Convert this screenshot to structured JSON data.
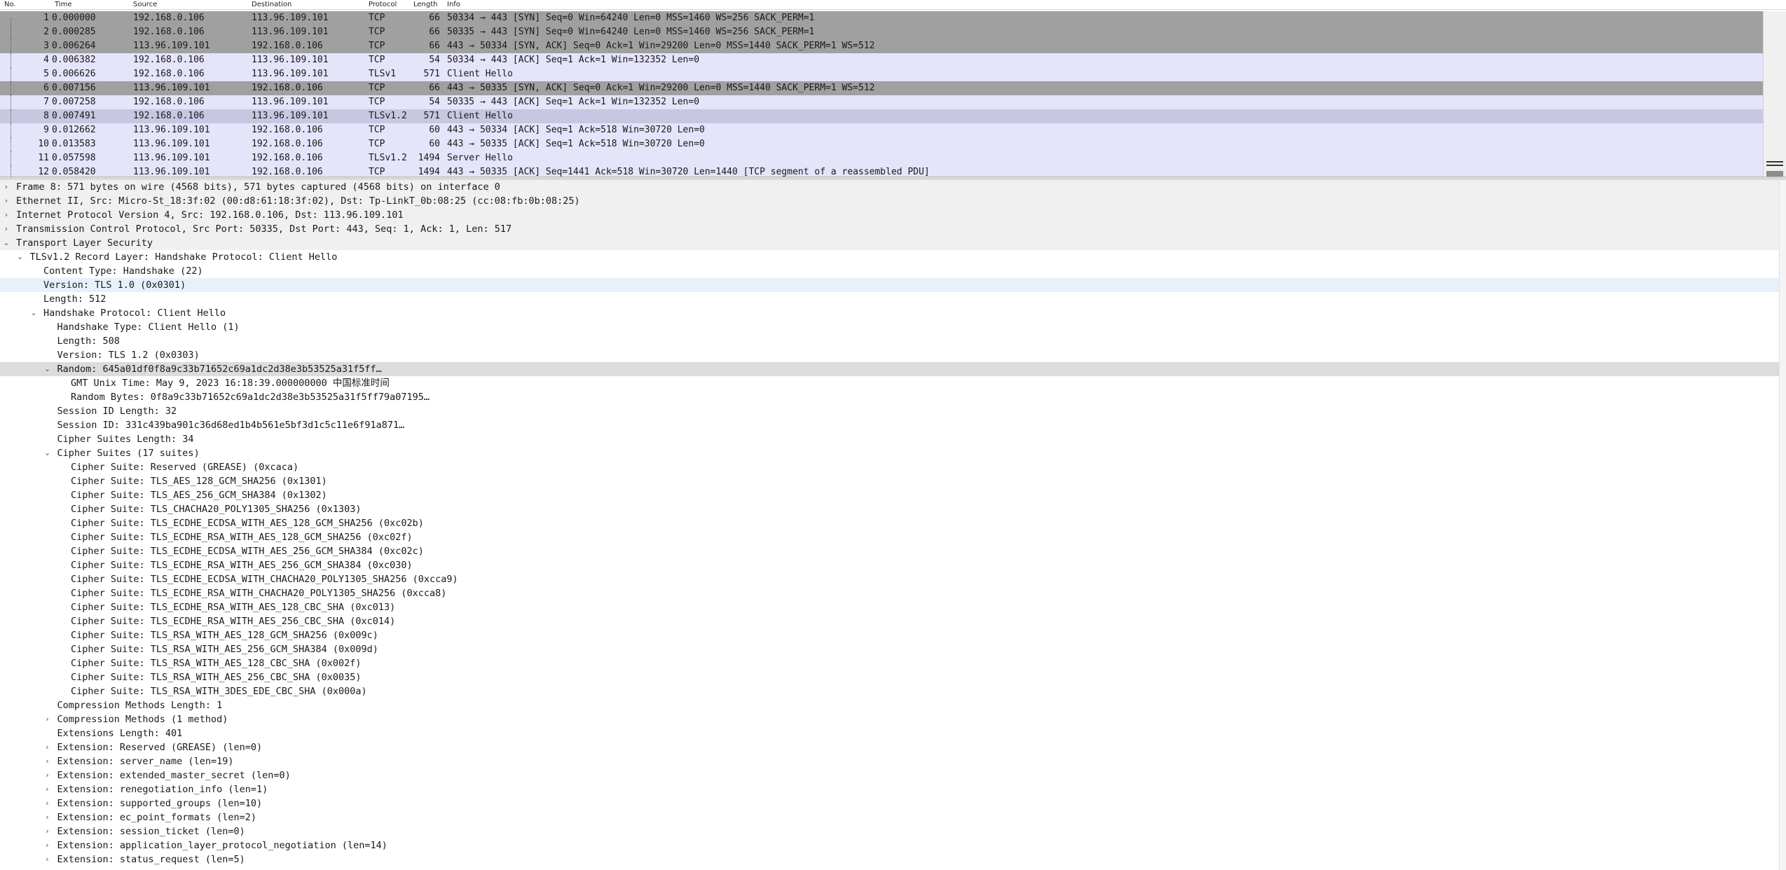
{
  "columns": {
    "no": "No.",
    "time": "Time",
    "source": "Source",
    "destination": "Destination",
    "protocol": "Protocol",
    "length": "Length",
    "info": "Info"
  },
  "packets": [
    {
      "no": "1",
      "time": "0.000000",
      "src": "192.168.0.106",
      "dst": "113.96.109.101",
      "proto": "TCP",
      "len": "66",
      "info": "50334 → 443 [SYN] Seq=0 Win=64240 Len=0 MSS=1460 WS=256 SACK_PERM=1",
      "style": "syn"
    },
    {
      "no": "2",
      "time": "0.000285",
      "src": "192.168.0.106",
      "dst": "113.96.109.101",
      "proto": "TCP",
      "len": "66",
      "info": "50335 → 443 [SYN] Seq=0 Win=64240 Len=0 MSS=1460 WS=256 SACK_PERM=1",
      "style": "syn"
    },
    {
      "no": "3",
      "time": "0.006264",
      "src": "113.96.109.101",
      "dst": "192.168.0.106",
      "proto": "TCP",
      "len": "66",
      "info": "443 → 50334 [SYN, ACK] Seq=0 Ack=1 Win=29200 Len=0 MSS=1440 SACK_PERM=1 WS=512",
      "style": "syn"
    },
    {
      "no": "4",
      "time": "0.006382",
      "src": "192.168.0.106",
      "dst": "113.96.109.101",
      "proto": "TCP",
      "len": "54",
      "info": "50334 → 443 [ACK] Seq=1 Ack=1 Win=132352 Len=0",
      "style": "tcp"
    },
    {
      "no": "5",
      "time": "0.006626",
      "src": "192.168.0.106",
      "dst": "113.96.109.101",
      "proto": "TLSv1",
      "len": "571",
      "info": "Client Hello",
      "style": "tcp"
    },
    {
      "no": "6",
      "time": "0.007156",
      "src": "113.96.109.101",
      "dst": "192.168.0.106",
      "proto": "TCP",
      "len": "66",
      "info": "443 → 50335 [SYN, ACK] Seq=0 Ack=1 Win=29200 Len=0 MSS=1440 SACK_PERM=1 WS=512",
      "style": "syn"
    },
    {
      "no": "7",
      "time": "0.007258",
      "src": "192.168.0.106",
      "dst": "113.96.109.101",
      "proto": "TCP",
      "len": "54",
      "info": "50335 → 443 [ACK] Seq=1 Ack=1 Win=132352 Len=0",
      "style": "tcp"
    },
    {
      "no": "8",
      "time": "0.007491",
      "src": "192.168.0.106",
      "dst": "113.96.109.101",
      "proto": "TLSv1.2",
      "len": "571",
      "info": "Client Hello",
      "style": "sel"
    },
    {
      "no": "9",
      "time": "0.012662",
      "src": "113.96.109.101",
      "dst": "192.168.0.106",
      "proto": "TCP",
      "len": "60",
      "info": "443 → 50334 [ACK] Seq=1 Ack=518 Win=30720 Len=0",
      "style": "tcp"
    },
    {
      "no": "10",
      "time": "0.013583",
      "src": "113.96.109.101",
      "dst": "192.168.0.106",
      "proto": "TCP",
      "len": "60",
      "info": "443 → 50335 [ACK] Seq=1 Ack=518 Win=30720 Len=0",
      "style": "tcp"
    },
    {
      "no": "11",
      "time": "0.057598",
      "src": "113.96.109.101",
      "dst": "192.168.0.106",
      "proto": "TLSv1.2",
      "len": "1494",
      "info": "Server Hello",
      "style": "tcp"
    },
    {
      "no": "12",
      "time": "0.058420",
      "src": "113.96.109.101",
      "dst": "192.168.0.106",
      "proto": "TCP",
      "len": "1494",
      "info": "443 → 50335 [ACK] Seq=1441 Ack=518 Win=30720 Len=1440 [TCP segment of a reassembled PDU]",
      "style": "tcp"
    }
  ],
  "details": [
    {
      "d": 0,
      "t": "c",
      "x": "Frame 8: 571 bytes on wire (4568 bits), 571 bytes captured (4568 bits) on interface 0",
      "s": "sec"
    },
    {
      "d": 0,
      "t": "c",
      "x": "Ethernet II, Src: Micro-St_18:3f:02 (00:d8:61:18:3f:02), Dst: Tp-LinkT_0b:08:25 (cc:08:fb:0b:08:25)",
      "s": "sec"
    },
    {
      "d": 0,
      "t": "c",
      "x": "Internet Protocol Version 4, Src: 192.168.0.106, Dst: 113.96.109.101",
      "s": "sec"
    },
    {
      "d": 0,
      "t": "c",
      "x": "Transmission Control Protocol, Src Port: 50335, Dst Port: 443, Seq: 1, Ack: 1, Len: 517",
      "s": "sec"
    },
    {
      "d": 0,
      "t": "e",
      "x": "Transport Layer Security",
      "s": "sec"
    },
    {
      "d": 1,
      "t": "e",
      "x": "TLSv1.2 Record Layer: Handshake Protocol: Client Hello",
      "s": ""
    },
    {
      "d": 2,
      "t": "n",
      "x": "Content Type: Handshake (22)",
      "s": ""
    },
    {
      "d": 2,
      "t": "n",
      "x": "Version: TLS 1.0 (0x0301)",
      "s": "hover"
    },
    {
      "d": 2,
      "t": "n",
      "x": "Length: 512",
      "s": ""
    },
    {
      "d": 2,
      "t": "e",
      "x": "Handshake Protocol: Client Hello",
      "s": ""
    },
    {
      "d": 3,
      "t": "n",
      "x": "Handshake Type: Client Hello (1)",
      "s": ""
    },
    {
      "d": 3,
      "t": "n",
      "x": "Length: 508",
      "s": ""
    },
    {
      "d": 3,
      "t": "n",
      "x": "Version: TLS 1.2 (0x0303)",
      "s": ""
    },
    {
      "d": 3,
      "t": "e",
      "x": "Random: 645a01df0f8a9c33b71652c69a1dc2d38e3b53525a31f5ff…",
      "s": "sel"
    },
    {
      "d": 4,
      "t": "n",
      "x": "GMT Unix Time: May  9, 2023 16:18:39.000000000 中国标准时间",
      "s": ""
    },
    {
      "d": 4,
      "t": "n",
      "x": "Random Bytes: 0f8a9c33b71652c69a1dc2d38e3b53525a31f5ff79a07195…",
      "s": ""
    },
    {
      "d": 3,
      "t": "n",
      "x": "Session ID Length: 32",
      "s": ""
    },
    {
      "d": 3,
      "t": "n",
      "x": "Session ID: 331c439ba901c36d68ed1b4b561e5bf3d1c5c11e6f91a871…",
      "s": ""
    },
    {
      "d": 3,
      "t": "n",
      "x": "Cipher Suites Length: 34",
      "s": ""
    },
    {
      "d": 3,
      "t": "e",
      "x": "Cipher Suites (17 suites)",
      "s": ""
    },
    {
      "d": 4,
      "t": "n",
      "x": "Cipher Suite: Reserved (GREASE) (0xcaca)",
      "s": ""
    },
    {
      "d": 4,
      "t": "n",
      "x": "Cipher Suite: TLS_AES_128_GCM_SHA256 (0x1301)",
      "s": ""
    },
    {
      "d": 4,
      "t": "n",
      "x": "Cipher Suite: TLS_AES_256_GCM_SHA384 (0x1302)",
      "s": ""
    },
    {
      "d": 4,
      "t": "n",
      "x": "Cipher Suite: TLS_CHACHA20_POLY1305_SHA256 (0x1303)",
      "s": ""
    },
    {
      "d": 4,
      "t": "n",
      "x": "Cipher Suite: TLS_ECDHE_ECDSA_WITH_AES_128_GCM_SHA256 (0xc02b)",
      "s": ""
    },
    {
      "d": 4,
      "t": "n",
      "x": "Cipher Suite: TLS_ECDHE_RSA_WITH_AES_128_GCM_SHA256 (0xc02f)",
      "s": ""
    },
    {
      "d": 4,
      "t": "n",
      "x": "Cipher Suite: TLS_ECDHE_ECDSA_WITH_AES_256_GCM_SHA384 (0xc02c)",
      "s": ""
    },
    {
      "d": 4,
      "t": "n",
      "x": "Cipher Suite: TLS_ECDHE_RSA_WITH_AES_256_GCM_SHA384 (0xc030)",
      "s": ""
    },
    {
      "d": 4,
      "t": "n",
      "x": "Cipher Suite: TLS_ECDHE_ECDSA_WITH_CHACHA20_POLY1305_SHA256 (0xcca9)",
      "s": ""
    },
    {
      "d": 4,
      "t": "n",
      "x": "Cipher Suite: TLS_ECDHE_RSA_WITH_CHACHA20_POLY1305_SHA256 (0xcca8)",
      "s": ""
    },
    {
      "d": 4,
      "t": "n",
      "x": "Cipher Suite: TLS_ECDHE_RSA_WITH_AES_128_CBC_SHA (0xc013)",
      "s": ""
    },
    {
      "d": 4,
      "t": "n",
      "x": "Cipher Suite: TLS_ECDHE_RSA_WITH_AES_256_CBC_SHA (0xc014)",
      "s": ""
    },
    {
      "d": 4,
      "t": "n",
      "x": "Cipher Suite: TLS_RSA_WITH_AES_128_GCM_SHA256 (0x009c)",
      "s": ""
    },
    {
      "d": 4,
      "t": "n",
      "x": "Cipher Suite: TLS_RSA_WITH_AES_256_GCM_SHA384 (0x009d)",
      "s": ""
    },
    {
      "d": 4,
      "t": "n",
      "x": "Cipher Suite: TLS_RSA_WITH_AES_128_CBC_SHA (0x002f)",
      "s": ""
    },
    {
      "d": 4,
      "t": "n",
      "x": "Cipher Suite: TLS_RSA_WITH_AES_256_CBC_SHA (0x0035)",
      "s": ""
    },
    {
      "d": 4,
      "t": "n",
      "x": "Cipher Suite: TLS_RSA_WITH_3DES_EDE_CBC_SHA (0x000a)",
      "s": ""
    },
    {
      "d": 3,
      "t": "n",
      "x": "Compression Methods Length: 1",
      "s": ""
    },
    {
      "d": 3,
      "t": "c",
      "x": "Compression Methods (1 method)",
      "s": ""
    },
    {
      "d": 3,
      "t": "n",
      "x": "Extensions Length: 401",
      "s": ""
    },
    {
      "d": 3,
      "t": "c",
      "x": "Extension: Reserved (GREASE) (len=0)",
      "s": ""
    },
    {
      "d": 3,
      "t": "c",
      "x": "Extension: server_name (len=19)",
      "s": ""
    },
    {
      "d": 3,
      "t": "c",
      "x": "Extension: extended_master_secret (len=0)",
      "s": ""
    },
    {
      "d": 3,
      "t": "c",
      "x": "Extension: renegotiation_info (len=1)",
      "s": ""
    },
    {
      "d": 3,
      "t": "c",
      "x": "Extension: supported_groups (len=10)",
      "s": ""
    },
    {
      "d": 3,
      "t": "c",
      "x": "Extension: ec_point_formats (len=2)",
      "s": ""
    },
    {
      "d": 3,
      "t": "c",
      "x": "Extension: session_ticket (len=0)",
      "s": ""
    },
    {
      "d": 3,
      "t": "c",
      "x": "Extension: application_layer_protocol_negotiation (len=14)",
      "s": ""
    },
    {
      "d": 3,
      "t": "c",
      "x": "Extension: status_request (len=5)",
      "s": ""
    }
  ],
  "icons": {
    "collapsed": "chevron-right-icon",
    "expanded": "chevron-down-icon"
  },
  "colors": {
    "syn_row": "#a0a0a0",
    "tcp_row": "#e4e4fa",
    "selected_row": "#c7c7e2",
    "tree_selected": "#dcdcdc",
    "tree_hover": "#e6f1fc"
  }
}
